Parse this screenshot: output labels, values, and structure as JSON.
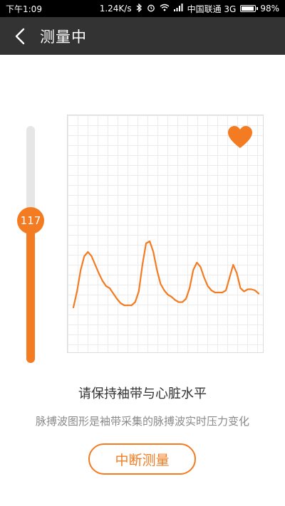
{
  "status_bar": {
    "time": "下午1:09",
    "speed": "1.24K/s",
    "carrier": "中国联通 3G",
    "battery": "98%"
  },
  "header": {
    "title": "测量中",
    "back_icon": "chevron-left-icon"
  },
  "pressure": {
    "value": "117",
    "level_fraction": 0.6
  },
  "chart_data": {
    "type": "line",
    "title": "",
    "xlabel": "",
    "ylabel": "",
    "grid": true,
    "series": [
      {
        "color": "#f37b21",
        "values": [
          0.2,
          0.35,
          0.55,
          0.68,
          0.72,
          0.68,
          0.6,
          0.52,
          0.45,
          0.4,
          0.38,
          0.33,
          0.28,
          0.24,
          0.22,
          0.22,
          0.22,
          0.25,
          0.35,
          0.6,
          0.8,
          0.82,
          0.72,
          0.55,
          0.42,
          0.36,
          0.32,
          0.3,
          0.27,
          0.25,
          0.25,
          0.28,
          0.38,
          0.55,
          0.62,
          0.58,
          0.48,
          0.4,
          0.36,
          0.34,
          0.34,
          0.34,
          0.36,
          0.48,
          0.6,
          0.52,
          0.38,
          0.35,
          0.37,
          0.37,
          0.36,
          0.33
        ]
      }
    ]
  },
  "heart_icon": "heart-icon",
  "accent_color": "#f37b21",
  "instruction": "请保持袖带与心脏水平",
  "subtext": "脉搏波图形是袖带采集的脉搏波实时压力变化",
  "stop_button": "中断测量"
}
